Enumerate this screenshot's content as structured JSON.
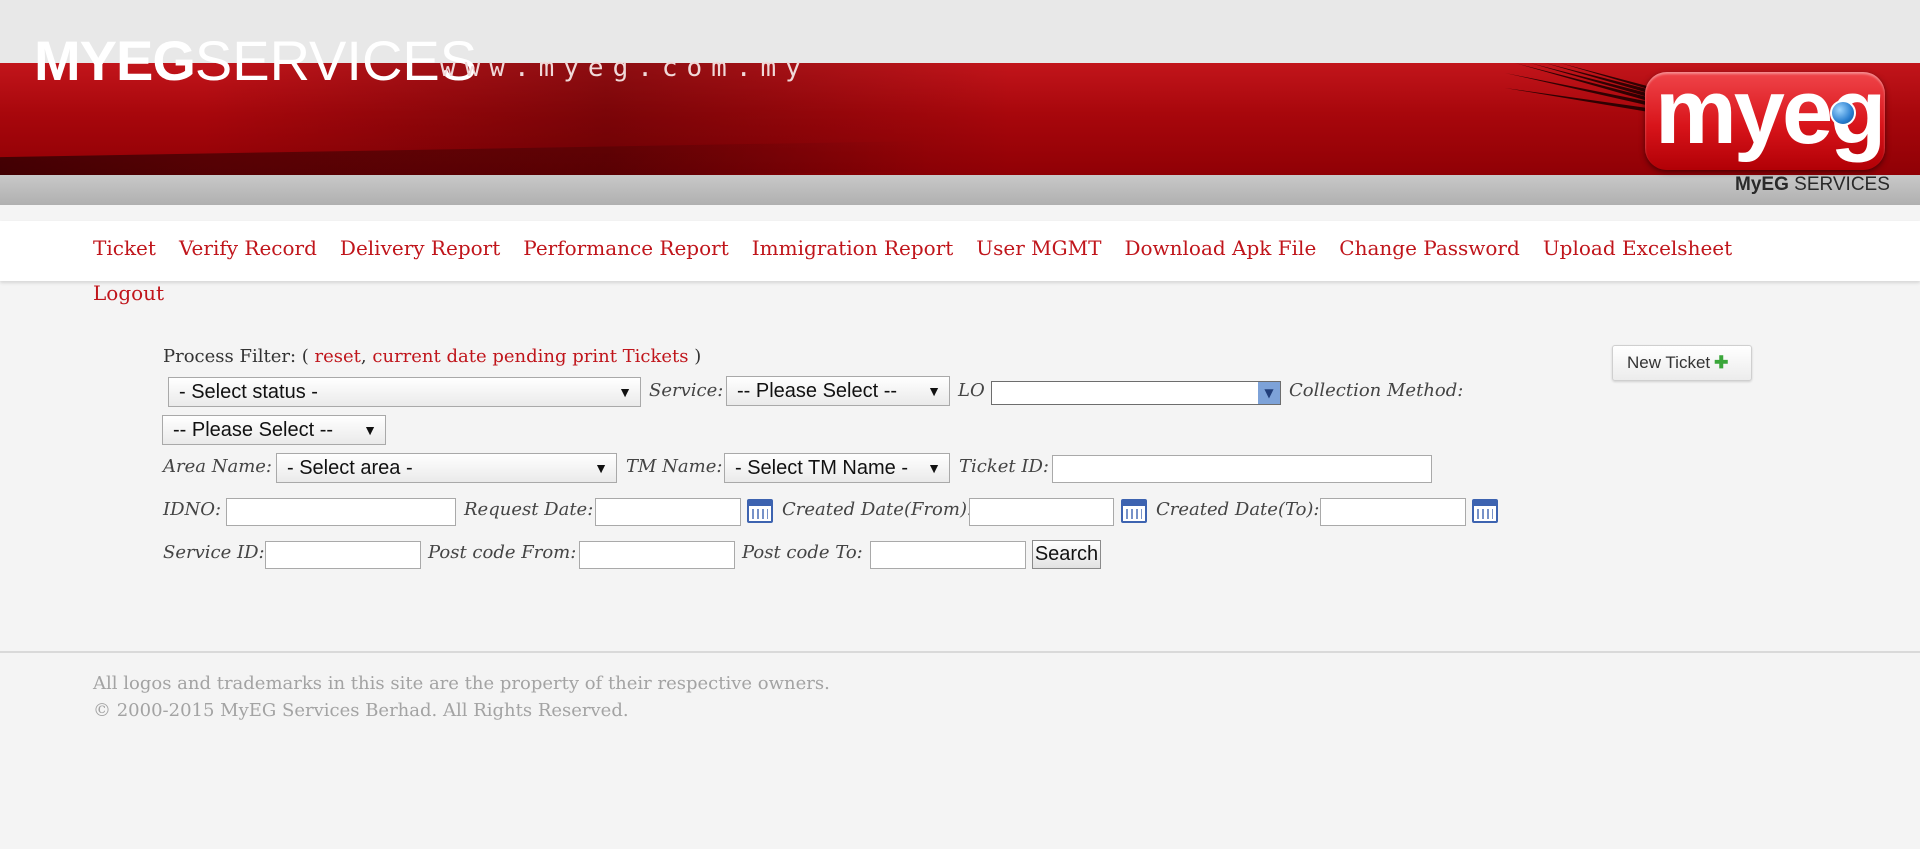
{
  "banner": {
    "brand_bold": "MYEG",
    "brand_light": "SERVICES",
    "url": "www.myeg.com.my",
    "logo": "myeg",
    "logo_sub_bold": "MyEG",
    "logo_sub_light": "SERVICES"
  },
  "nav": {
    "items": [
      "Ticket",
      "Verify Record",
      "Delivery Report",
      "Performance Report",
      "Immigration Report",
      "User MGMT",
      "Download Apk File",
      "Change Password",
      "Upload Excelsheet"
    ],
    "logout": "Logout"
  },
  "filter": {
    "process_label": "Process Filter: (",
    "reset_link": "reset",
    "pending_link": "current date pending print Tickets",
    "close_paren": ")",
    "status_select": "- Select status -",
    "service_label": "Service:",
    "service_select": "-- Please Select --",
    "lo_label": "LO",
    "lo_value": "",
    "collection_label": "Collection Method:",
    "collection_select": "-- Please Select --",
    "area_label": "Area Name:",
    "area_select": "- Select area -",
    "tm_label": "TM Name:",
    "tm_select": "- Select TM Name -",
    "ticket_id_label": "Ticket ID:",
    "ticket_id_value": "",
    "idno_label": "IDNO:",
    "idno_value": "",
    "request_date_label": "Request Date:",
    "request_date_value": "",
    "created_from_label": "Created Date(From):",
    "created_from_value": "",
    "created_to_label": "Created Date(To):",
    "created_to_value": "",
    "service_id_label": "Service ID:",
    "service_id_value": "",
    "postcode_from_label": "Post code From:",
    "postcode_from_value": "",
    "postcode_to_label": "Post code To:",
    "postcode_to_value": "",
    "search_button": "Search",
    "new_ticket_button": "New Ticket",
    "new_ticket_icon": "plus-icon"
  },
  "footer": {
    "line1": "All logos and trademarks in this site are the property of their respective owners.",
    "line2": "© 2000-2015 MyEG Services Berhad. All Rights Reserved."
  },
  "colors": {
    "brand_red": "#c0151b",
    "banner_red": "#a8070c",
    "calendar_blue": "#3d63b0"
  }
}
